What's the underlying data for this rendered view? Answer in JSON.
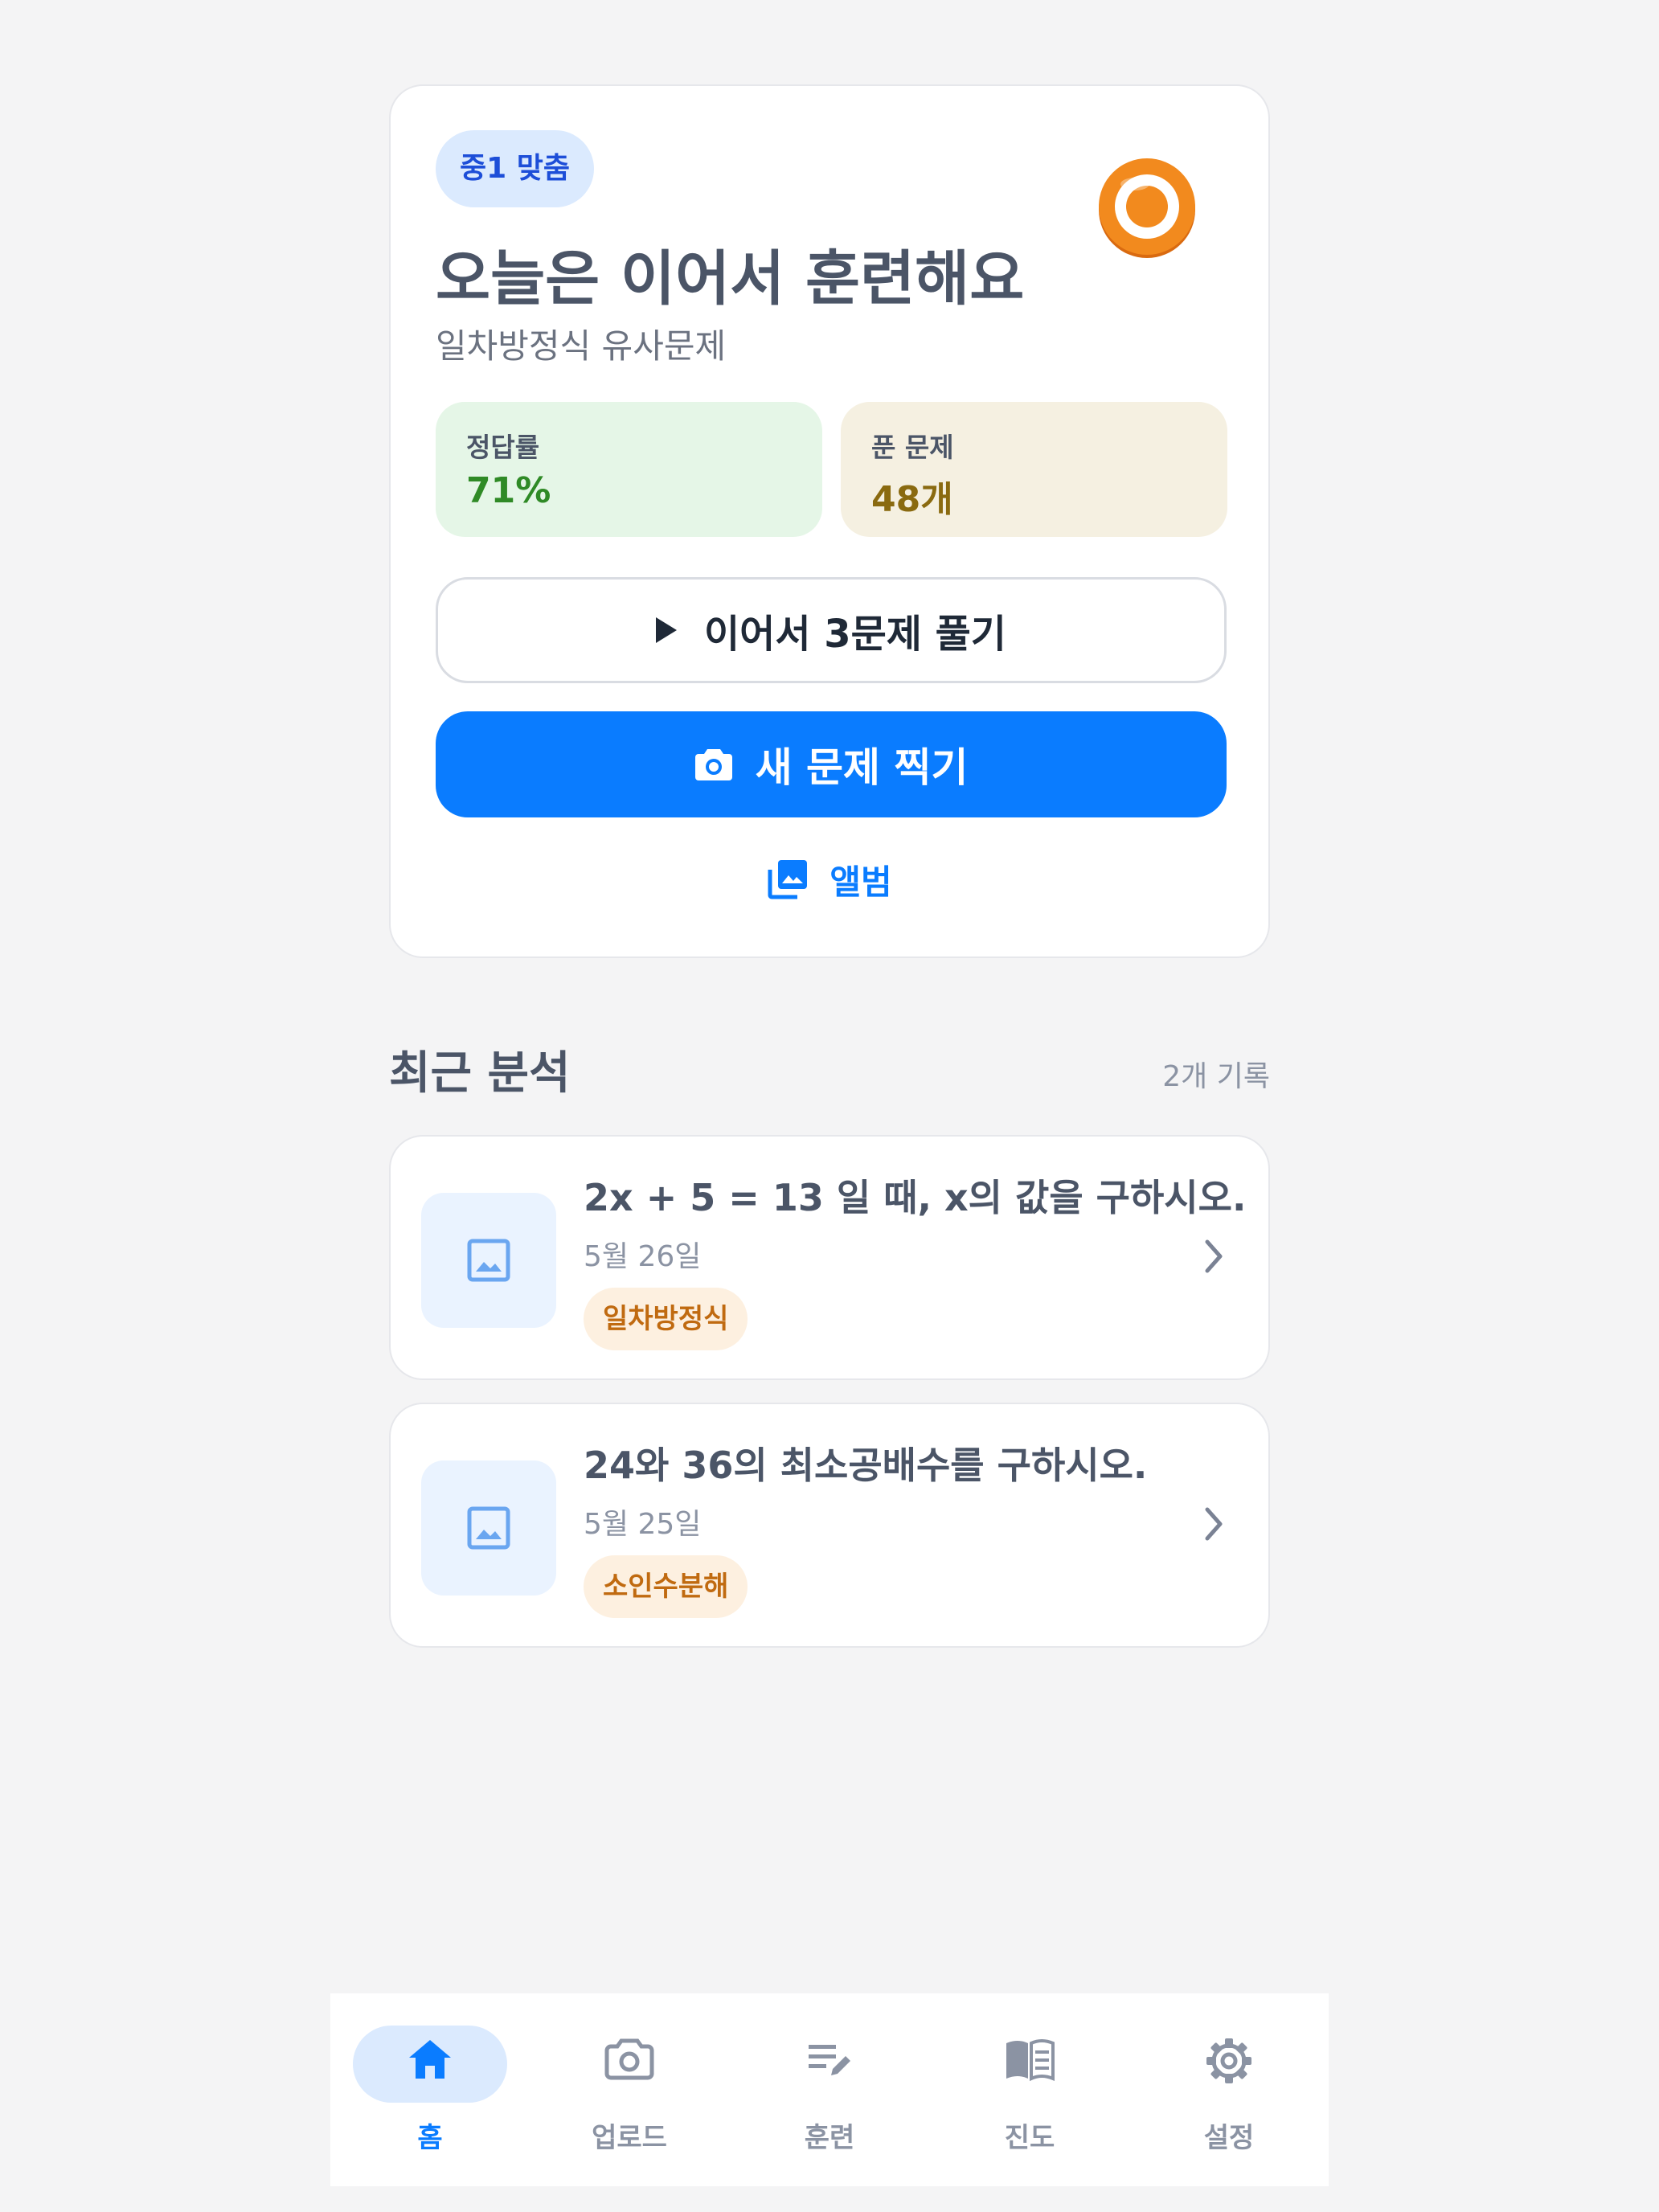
{
  "hero": {
    "level_badge": "중1 맞춤",
    "title": "오늘은 이어서 훈련해요",
    "subtitle": "일차방정식 유사문제",
    "stats": {
      "accuracy_label": "정답률",
      "accuracy_value": "71%",
      "solved_label": "푼 문제",
      "solved_value": "48개"
    },
    "continue_label": "이어서 3문제 풀기",
    "camera_label": "새 문제 찍기",
    "album_label": "앨범"
  },
  "recent": {
    "title": "최근 분석",
    "count": "2개 기록",
    "items": [
      {
        "question": "2x + 5 = 13 일 때, x의 값을 구하시오.",
        "date": "5월 26일",
        "tag": "일차방정식"
      },
      {
        "question": "24와 36의 최소공배수를 구하시오.",
        "date": "5월 25일",
        "tag": "소인수분해"
      }
    ]
  },
  "nav": {
    "items": [
      {
        "label": "홈",
        "icon": "home-icon",
        "active": true
      },
      {
        "label": "업로드",
        "icon": "camera-icon"
      },
      {
        "label": "훈련",
        "icon": "edit-list-icon"
      },
      {
        "label": "진도",
        "icon": "book-icon"
      },
      {
        "label": "설정",
        "icon": "gear-icon"
      }
    ]
  },
  "colors": {
    "primary": "#0a7cff",
    "accuracy": "#2f8a26",
    "solved": "#8a6a10",
    "tag": "#c06a10",
    "target": "#f28a1e"
  }
}
